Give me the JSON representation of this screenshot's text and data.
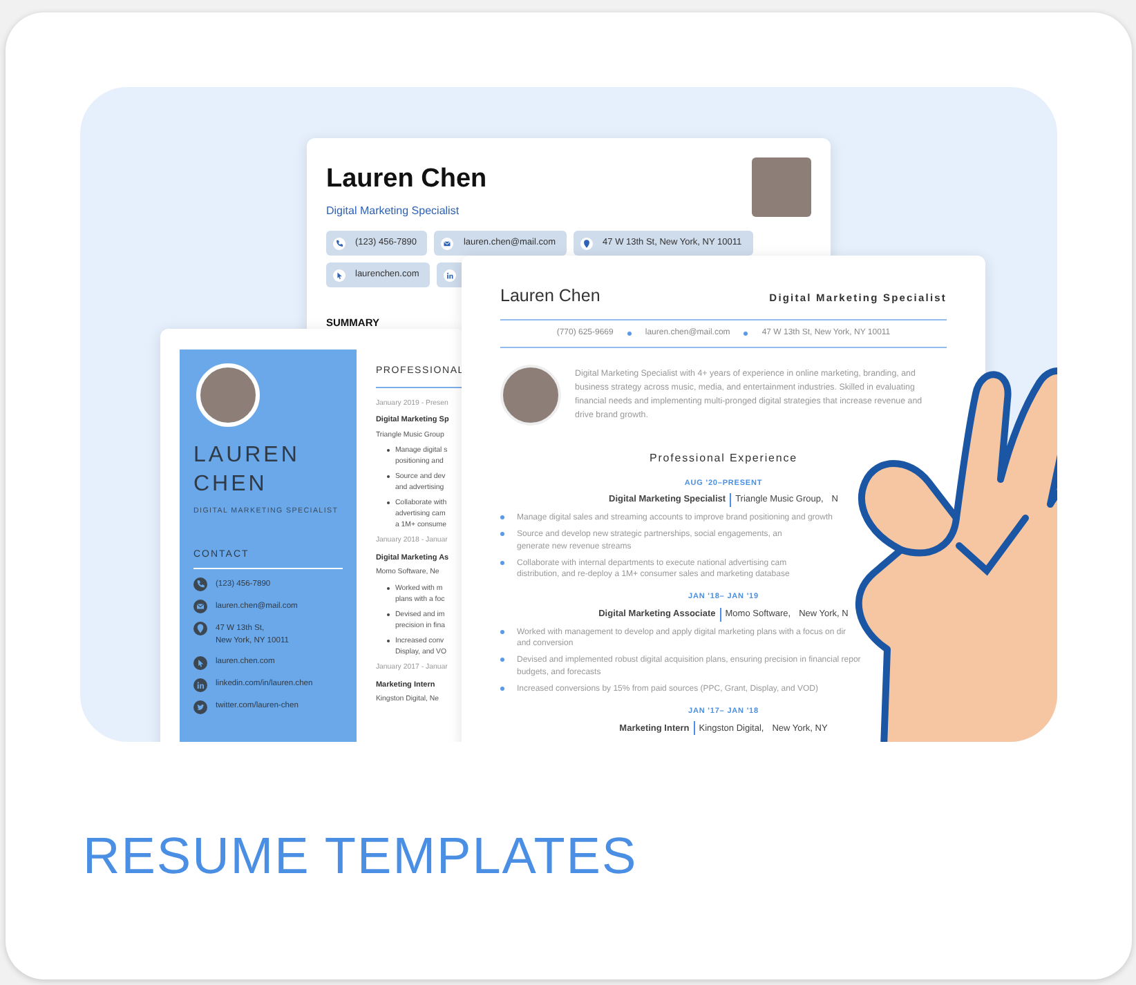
{
  "back_resume": {
    "name": "Lauren Chen",
    "title": "Digital Marketing Specialist",
    "contacts": [
      {
        "kind": "phone",
        "text": "(123) 456-7890"
      },
      {
        "kind": "email",
        "text": "lauren.chen@mail.com"
      },
      {
        "kind": "location",
        "text": "47 W 13th St, New York, NY 10011"
      },
      {
        "kind": "website",
        "text": "laurenchen.com"
      },
      {
        "kind": "linkedin"
      }
    ],
    "section": "SUMMARY"
  },
  "side_resume": {
    "name": "LAUREN CHEN",
    "title": "DIGITAL MARKETING SPECIALIST",
    "contact_heading": "CONTACT",
    "contacts": [
      {
        "kind": "phone",
        "lines": [
          "(123) 456-7890"
        ]
      },
      {
        "kind": "email",
        "lines": [
          "lauren.chen@mail.com"
        ]
      },
      {
        "kind": "location",
        "lines": [
          "47 W 13th St,",
          "New York, NY 10011"
        ]
      },
      {
        "kind": "website",
        "lines": [
          "lauren.chen.com"
        ]
      },
      {
        "kind": "linkedin",
        "lines": [
          "linkedin.com/in/lauren.chen"
        ]
      },
      {
        "kind": "twitter",
        "lines": [
          "twitter.com/lauren-chen"
        ]
      }
    ],
    "section": "PROFESSIONAL",
    "jobs": [
      {
        "date": "January 2019 - Presen",
        "role": "Digital Marketing Sp",
        "company": "Triangle Music Group",
        "bullets": [
          [
            "Manage digital s",
            "positioning and"
          ],
          [
            "Source and dev",
            "and advertising"
          ],
          [
            "Collaborate with",
            "advertising cam",
            "a 1M+ consume"
          ]
        ]
      },
      {
        "date": "January 2018 - Januar",
        "role": "Digital Marketing As",
        "company": "Momo Software,   Ne",
        "bullets": [
          [
            "Worked with m",
            "plans with a foc"
          ],
          [
            "Devised and im",
            "precision in fina"
          ],
          [
            "Increased conv",
            "Display, and VO"
          ]
        ]
      },
      {
        "date": "January 2017 - Januar",
        "role": "Marketing Intern",
        "company": "Kingston Digital,   Ne"
      }
    ]
  },
  "front_resume": {
    "name": "Lauren Chen",
    "title": "Digital Marketing Specialist",
    "contacts": [
      "(770) 625-9669",
      "lauren.chen@mail.com",
      "47 W 13th St, New York, NY 10011"
    ],
    "summary": "Digital Marketing Specialist with 4+ years of experience in online marketing, branding, and business strategy across music, media, and entertainment industries. Skilled in evaluating financial needs and implementing multi-pronged digital strategies that increase revenue and drive brand growth.",
    "section": "Professional Experience",
    "jobs": [
      {
        "date": "AUG '20–PRESENT",
        "role": "Digital Marketing Specialist",
        "company": "Triangle Music Group,",
        "location": "N",
        "bullets": [
          [
            "Manage digital sales and streaming accounts to improve brand positioning and growth"
          ],
          [
            "Source and develop new strategic partnerships, social engagements, an",
            "generate new revenue streams"
          ],
          [
            "Collaborate with internal departments to execute national advertising cam",
            "distribution, and re-deploy a 1M+ consumer sales and marketing database"
          ]
        ]
      },
      {
        "date": "JAN '18– JAN '19",
        "role": "Digital Marketing Associate",
        "company": "Momo Software,",
        "location": "New York, N",
        "bullets": [
          [
            "Worked with management to develop and apply digital marketing plans with a focus on dir",
            "and conversion"
          ],
          [
            "Devised and implemented robust digital acquisition plans, ensuring precision in financial repor",
            "budgets, and forecasts"
          ],
          [
            "Increased conversions by 15% from paid sources (PPC, Grant, Display, and VOD)"
          ]
        ]
      },
      {
        "date": "JAN '17– JAN '18",
        "role": "Marketing Intern",
        "company": "Kingston Digital,",
        "location": "New York, NY"
      }
    ]
  },
  "caption": "RESUME TEMPLATES"
}
